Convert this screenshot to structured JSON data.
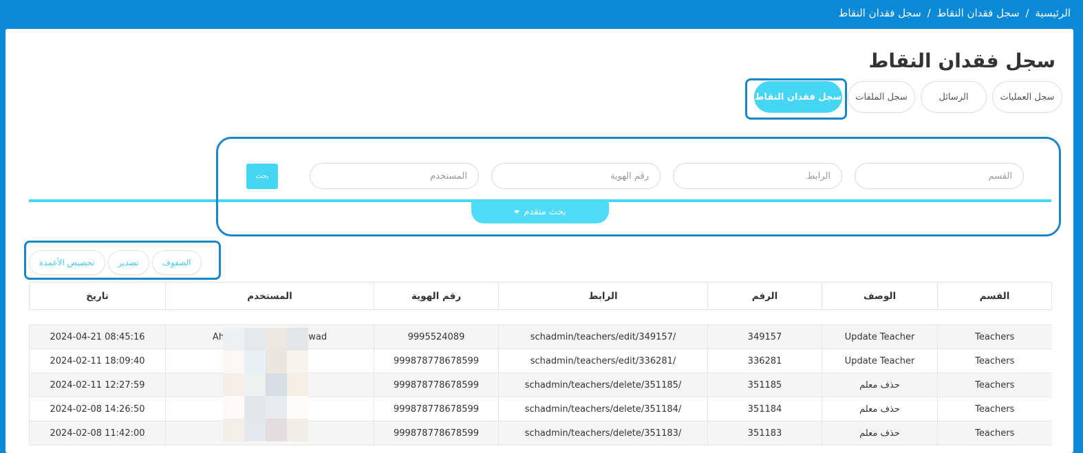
{
  "breadcrumb": {
    "home": "الرئيسية",
    "section": "سجل فقدان النقاط",
    "current": "سجل فقدان النقاط",
    "separator": "/"
  },
  "page_title": "سجل فقدان النقاط",
  "tabs": [
    {
      "label": "سجل العمليات",
      "active": false
    },
    {
      "label": "الرسائل",
      "active": false
    },
    {
      "label": "سجل الملفات",
      "active": false
    },
    {
      "label": "سجل فقدان النقاط",
      "active": true
    }
  ],
  "search": {
    "section_placeholder": "القسم",
    "link_placeholder": "الرابط",
    "id_placeholder": "رقم الهوية",
    "user_placeholder": "المستخدم",
    "search_button": "بحث",
    "advanced_search": "بحث متقدم"
  },
  "toolbar": {
    "rows": "الصفوف",
    "export": "تصدير",
    "columns": "تخصيص الأعمدة"
  },
  "table": {
    "headers": [
      "القسم",
      "الوصف",
      "الرقم",
      "الرابط",
      "رقم الهوية",
      "المستخدم",
      "تاريخ"
    ],
    "rows": [
      {
        "section": "Teachers",
        "description": "Update Teacher",
        "number": "349157",
        "link": "schadmin/teachers/edit/349157/",
        "id_number": "9995524089",
        "user": "Ahm                    gawwad",
        "date": "2024-04-21 08:45:16"
      },
      {
        "section": "Teachers",
        "description": "Update Teacher",
        "number": "336281",
        "link": "schadmin/teachers/edit/336281/",
        "id_number": "999878778678599",
        "user": "",
        "date": "2024-02-11 18:09:40"
      },
      {
        "section": "Teachers",
        "description": "حذف معلم",
        "number": "351185",
        "link": "schadmin/teachers/delete/351185/",
        "id_number": "999878778678599",
        "user": "",
        "date": "2024-02-11 12:27:59"
      },
      {
        "section": "Teachers",
        "description": "حذف معلم",
        "number": "351184",
        "link": "schadmin/teachers/delete/351184/",
        "id_number": "999878778678599",
        "user": "",
        "date": "2024-02-08 14:26:50"
      },
      {
        "section": "Teachers",
        "description": "حذف معلم",
        "number": "351183",
        "link": "schadmin/teachers/delete/351183/",
        "id_number": "999878778678599",
        "user": "",
        "date": "2024-02-08 11:42:00"
      }
    ]
  },
  "colors": {
    "topbar": "#0a8ad6",
    "accent": "#45d6f4",
    "highlight_border": "#1a86c8"
  }
}
